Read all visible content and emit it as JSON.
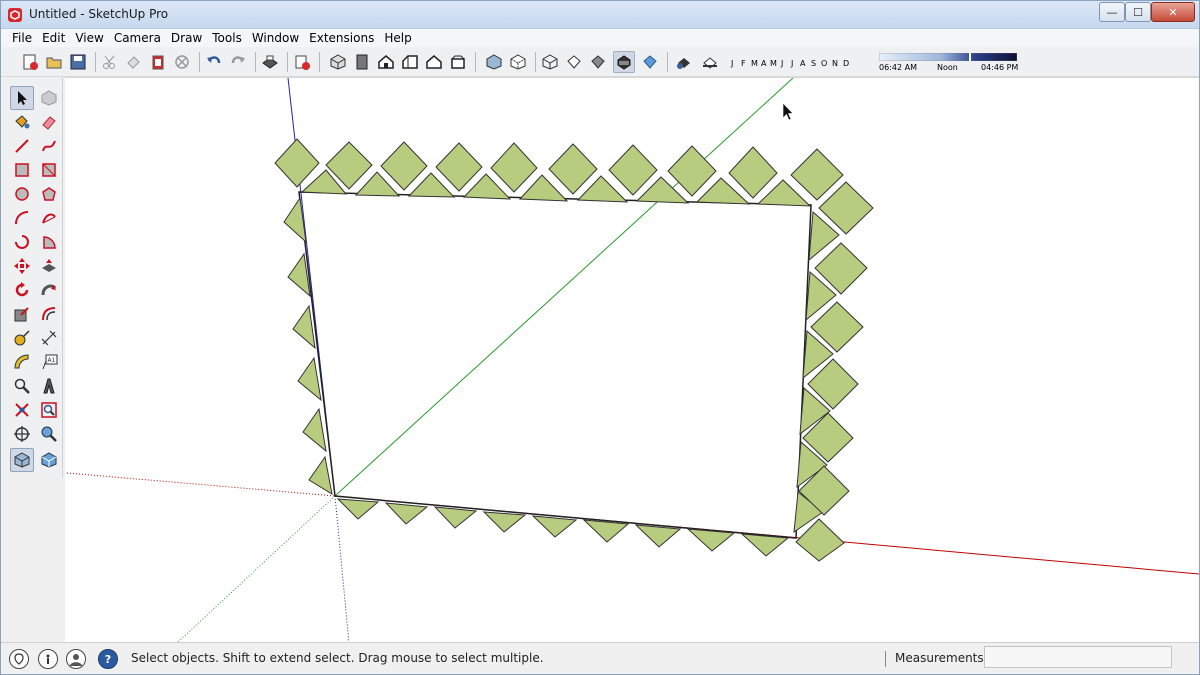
{
  "window": {
    "title": "Untitled - SketchUp Pro",
    "min_glyph": "—",
    "max_glyph": "☐",
    "close_glyph": "✕"
  },
  "menu": {
    "items": [
      "File",
      "Edit",
      "View",
      "Camera",
      "Draw",
      "Tools",
      "Window",
      "Extensions",
      "Help"
    ]
  },
  "shadow": {
    "months": [
      "J",
      "F",
      "M",
      "A",
      "M",
      "J",
      "J",
      "A",
      "S",
      "O",
      "N",
      "D"
    ],
    "time_start": "06:42 AM",
    "time_noon": "Noon",
    "time_end": "04:46 PM"
  },
  "status": {
    "message": "Select objects. Shift to extend select. Drag mouse to select multiple.",
    "help_glyph": "?",
    "measurements_label": "Measurements",
    "measurements_value": ""
  },
  "colors": {
    "shape_fill": "#b8cc7f",
    "axis_red": "#c00000",
    "axis_green": "#2a9a2a",
    "axis_blue": "#2222aa",
    "active_tool": "#cfd8e4"
  },
  "icons": {
    "toolbar": [
      "new-icon",
      "open-icon",
      "save-icon",
      "cut-icon",
      "copy-icon",
      "paste-icon",
      "erase-icon",
      "undo-icon",
      "redo-icon",
      "print-icon",
      "model-info-icon",
      "iso-view-icon",
      "top-view-icon",
      "front-view-icon",
      "right-view-icon",
      "back-view-icon",
      "left-view-icon",
      "xray-icon",
      "back-edges-icon",
      "wireframe-icon",
      "hidden-line-icon",
      "shaded-icon",
      "shaded-textures-icon",
      "monochrome-icon",
      "shadows-icon",
      "fog-icon"
    ],
    "left_tools": [
      "select-icon",
      "component-icon",
      "paint-bucket-icon",
      "eraser-icon",
      "line-icon",
      "freehand-icon",
      "rectangle-icon",
      "rotated-rect-icon",
      "circle-icon",
      "polygon-icon",
      "arc-icon",
      "arc-3point-icon",
      "pie-icon",
      "arc-2point-icon",
      "move-icon",
      "push-pull-icon",
      "rotate-icon",
      "follow-me-icon",
      "scale-icon",
      "offset-icon",
      "tape-measure-icon",
      "dimension-icon",
      "protractor-icon",
      "text-icon",
      "axes-icon",
      "3d-text-icon",
      "orbit-icon",
      "pan-icon",
      "zoom-icon",
      "zoom-window-icon",
      "zoom-extents-icon",
      "walk-icon",
      "position-camera-icon",
      "look-around-icon",
      "section-plane-icon",
      "warehouse-icon"
    ]
  }
}
